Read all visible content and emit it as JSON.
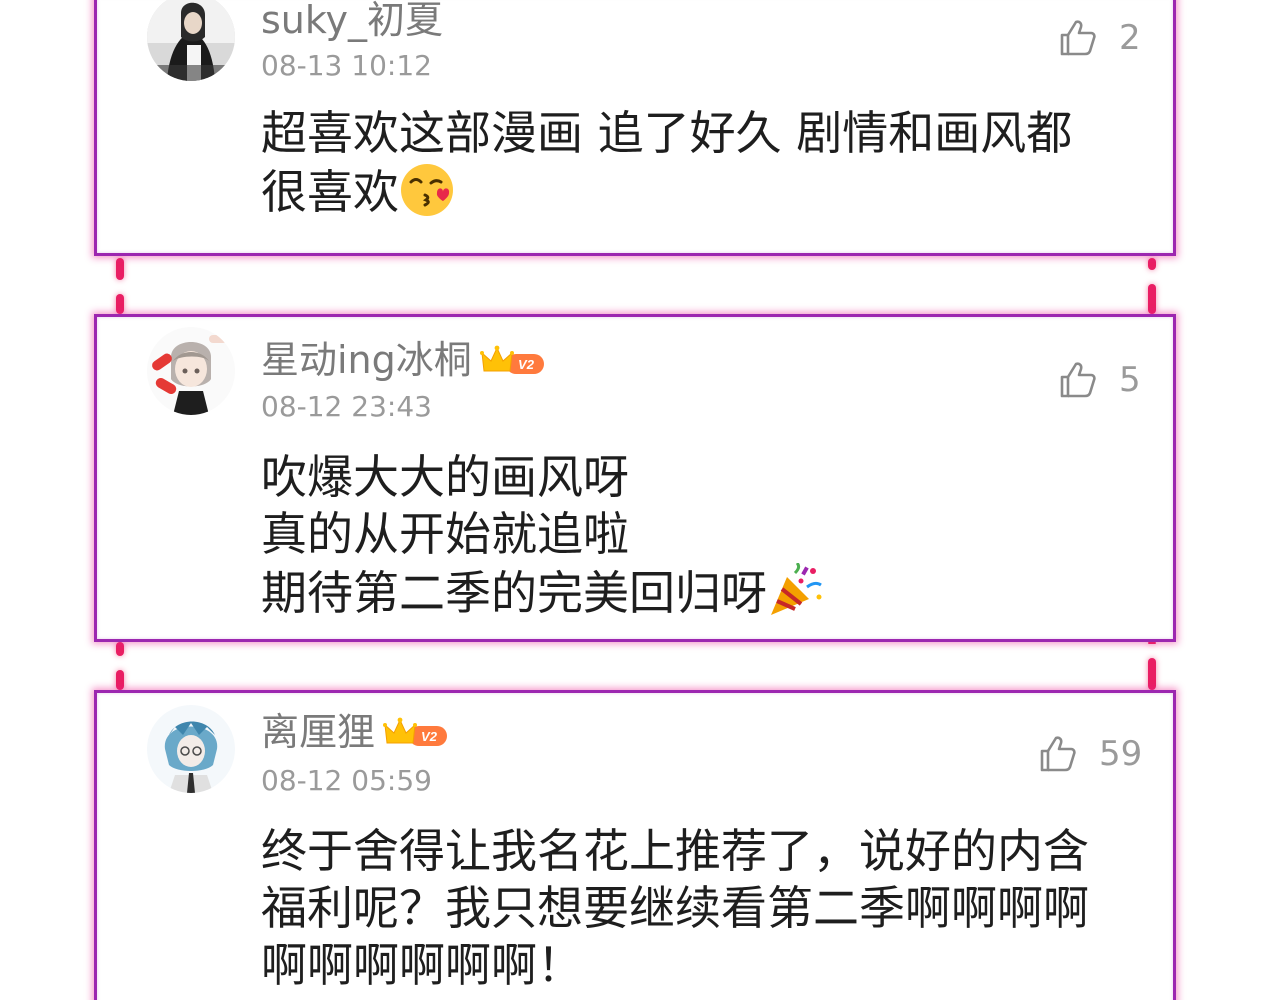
{
  "comments": [
    {
      "username": "suky_初夏",
      "timestamp": "08-13 10:12",
      "likes": "2",
      "vip_level": "",
      "text_lines": [
        "超喜欢这部漫画 追了好久 剧情和画风都",
        "很喜欢"
      ],
      "trailing_emoji": "kiss-emoji"
    },
    {
      "username": "星动ing冰桐",
      "timestamp": "08-12 23:43",
      "likes": "5",
      "vip_level": "V2",
      "text_lines": [
        "吹爆大大的画风呀",
        "真的从开始就追啦",
        "期待第二季的完美回归呀"
      ],
      "trailing_emoji": "party-popper-emoji"
    },
    {
      "username": "离厘狸",
      "timestamp": "08-12 05:59",
      "likes": "59",
      "vip_level": "V2",
      "text_lines": [
        "终于舍得让我名花上推荐了，说好的内含",
        "福利呢？我只想要继续看第二季啊啊啊啊",
        "啊啊啊啊啊啊！"
      ],
      "trailing_emoji": ""
    }
  ],
  "colors": {
    "card_border": "#9c27b0",
    "connector": "#e91e63",
    "vip_badge": "#ff7a3d",
    "crown": "#ffc107",
    "username": "#7a7a7a",
    "timestamp": "#9a9a9a",
    "comment_text": "#1e1e1e"
  },
  "icons": [
    "thumbs-up-icon",
    "crown-icon",
    "kiss-emoji",
    "party-popper-emoji"
  ]
}
